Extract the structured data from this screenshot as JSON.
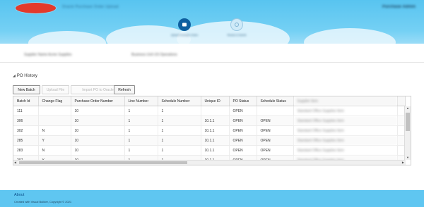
{
  "header": {
    "app_title": "Oracle Purchase Order Upload",
    "user_name": "Purchase Admin",
    "steps": [
      {
        "label": "Upload Purchase Orders",
        "state": "active"
      },
      {
        "label": "Review & Submit",
        "state": "inactive"
      }
    ]
  },
  "info_bar": {
    "field_1": "Supplier Name  Acme Supplies",
    "field_2": "Business Unit  US Operations"
  },
  "section": {
    "title": "PO History"
  },
  "toolbar": {
    "new_batch": "New Batch",
    "upload_file": "Upload File",
    "import_po": "Import PO to Oracle",
    "refresh": "Refresh"
  },
  "table": {
    "columns": [
      "Batch Id",
      "Change Flag",
      "Purchase Order Number",
      "Line Number",
      "Schedule Number",
      "Unique ID",
      "PO Status",
      "Schedule Status",
      "Supplier Item",
      ""
    ],
    "rows": [
      [
        "111",
        "",
        "10",
        "1",
        "1",
        "",
        "OPEN",
        "",
        "Standard Office Supplies Item",
        ""
      ],
      [
        "306",
        "",
        "10",
        "1",
        "1",
        "10.1.1",
        "OPEN",
        "OPEN",
        "Standard Office Supplies Item",
        ""
      ],
      [
        "302",
        "N",
        "10",
        "1",
        "1",
        "10.1.1",
        "OPEN",
        "OPEN",
        "Standard Office Supplies Item",
        ""
      ],
      [
        "285",
        "Y",
        "10",
        "1",
        "1",
        "10.1.1",
        "OPEN",
        "OPEN",
        "Standard Office Supplies Item",
        ""
      ],
      [
        "283",
        "N",
        "10",
        "1",
        "1",
        "10.1.1",
        "OPEN",
        "OPEN",
        "Standard Office Supplies Item",
        ""
      ],
      [
        "207",
        "Y",
        "10",
        "1",
        "1",
        "10.1.1",
        "OPEN",
        "OPEN",
        "Standard Office Supplies Item",
        ""
      ]
    ]
  },
  "footer": {
    "about": "About",
    "copyright": "Created with Visual Builder, Copyright © 2021"
  },
  "colors": {
    "header_bg": "#58c4f0",
    "footer_bg": "#5fc6f1",
    "logo": "#e23a2c",
    "step_active": "#0f5fa0"
  }
}
